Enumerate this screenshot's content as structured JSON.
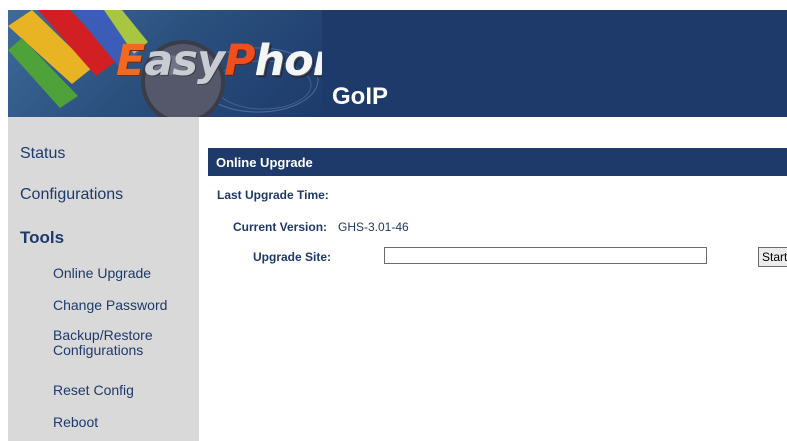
{
  "header": {
    "logo_text": "EasyPhone",
    "logo_parts": {
      "e": "E",
      "sy": "asy",
      "p": "P",
      "hone": "hone"
    },
    "product_name": "GoIP",
    "colors": {
      "header_bg": "#1d3a6b",
      "logo_orange": "#f06a22",
      "logo_red": "#ee4f1d",
      "logo_stripes": [
        "#e8b423",
        "#d21f23",
        "#3b5db8",
        "#4fa23a"
      ]
    }
  },
  "sidebar": {
    "background": "#d9d9d9",
    "items": [
      {
        "label": "Status"
      },
      {
        "label": "Configurations"
      },
      {
        "label": "Tools"
      },
      {
        "label": "Online Upgrade"
      },
      {
        "label": "Change Password"
      },
      {
        "label": "Backup/Restore\nConfigurations"
      },
      {
        "label": "Reset Config"
      },
      {
        "label": "Reboot"
      }
    ]
  },
  "main": {
    "section_title": "Online Upgrade",
    "last_upgrade_time": {
      "label": "Last Upgrade Time:",
      "value": ""
    },
    "current_version": {
      "label": "Current Version:",
      "value": "GHS-3.01-46"
    },
    "upgrade_site": {
      "label": "Upgrade Site:",
      "value": "",
      "placeholder": ""
    },
    "start_button_label": "Start"
  }
}
